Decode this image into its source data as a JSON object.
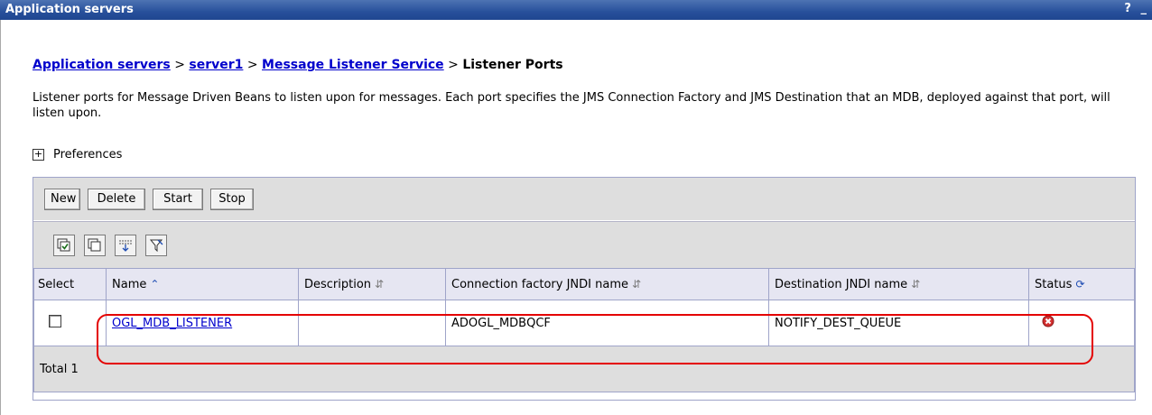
{
  "window": {
    "title": "Application servers",
    "help_label": "?",
    "minimize_label": "_"
  },
  "breadcrumb": {
    "links": [
      "Application servers",
      "server1",
      "Message Listener Service"
    ],
    "separator": ">",
    "current": "Listener Ports"
  },
  "description": "Listener ports for Message Driven Beans to listen upon for messages. Each port specifies the JMS Connection Factory and JMS Destination that an MDB, deployed against that port, will listen upon.",
  "preferences": {
    "expander": "+",
    "label": "Preferences"
  },
  "toolbar": {
    "new": "New",
    "delete": "Delete",
    "start": "Start",
    "stop": "Stop"
  },
  "icon_toolbar": [
    "select-all-icon",
    "deselect-all-icon",
    "show-filter-icon",
    "clear-filter-icon"
  ],
  "table": {
    "headers": {
      "select": "Select",
      "name": "Name",
      "description": "Description",
      "connection_factory": "Connection factory JNDI name",
      "destination": "Destination JNDI name",
      "status": "Status"
    },
    "rows": [
      {
        "name": "OGL_MDB_LISTENER",
        "description": "",
        "connection_factory": "ADOGL_MDBQCF",
        "destination": "NOTIFY_DEST_QUEUE",
        "status_icon": "stopped-status-icon"
      }
    ],
    "total": "Total 1"
  },
  "colors": {
    "titlebar": "#27509b",
    "link": "#0000cc",
    "highlight": "#e40000",
    "header_bg": "#e6e6f2"
  }
}
